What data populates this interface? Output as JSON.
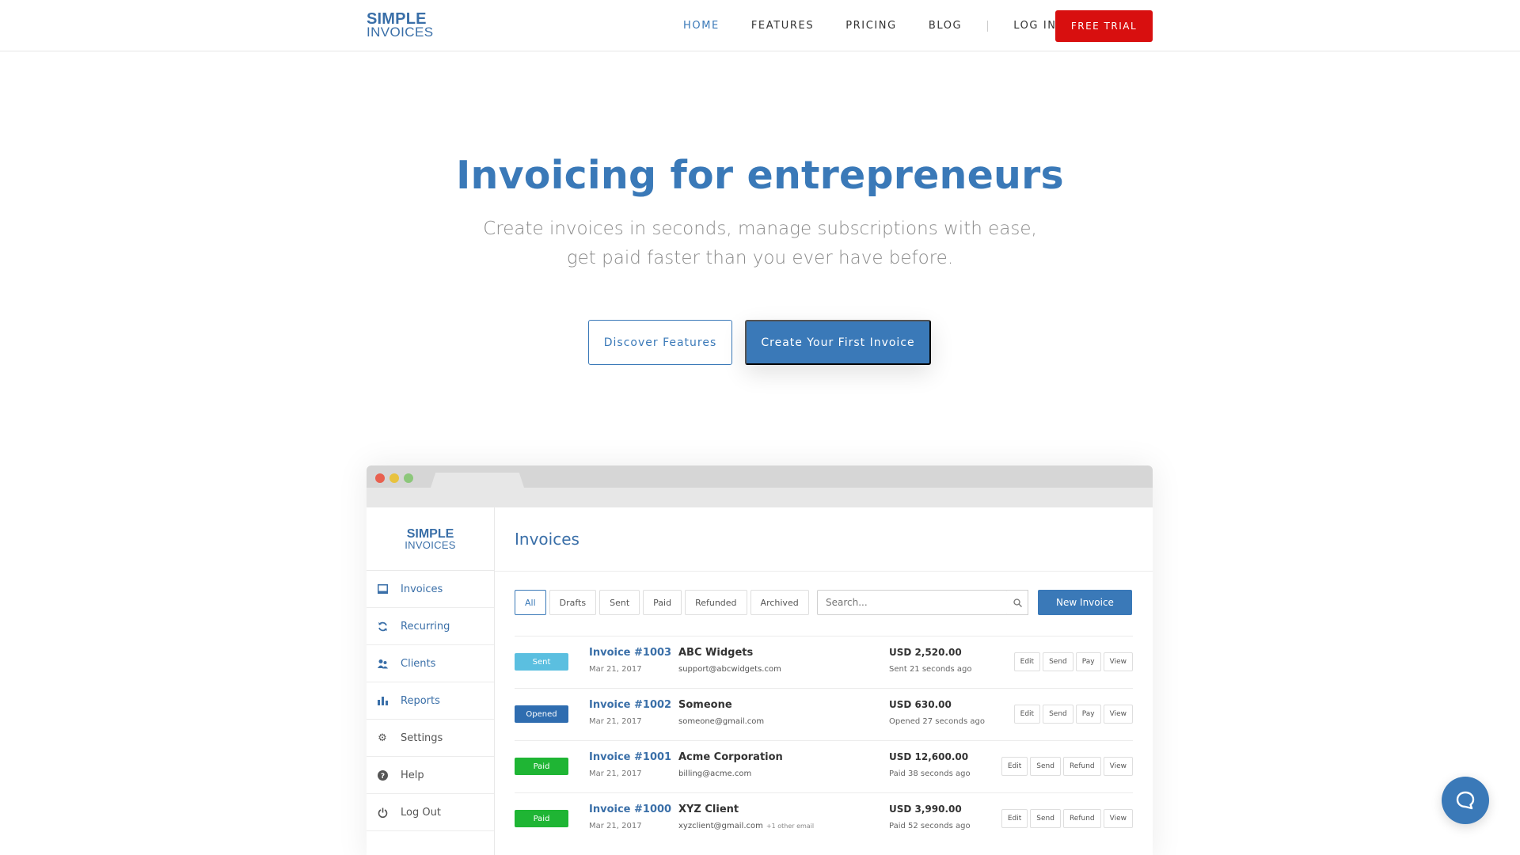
{
  "brand": {
    "line1": "SIMPLE",
    "line2": "INVOICES"
  },
  "nav": {
    "links": [
      "HOME",
      "FEATURES",
      "PRICING",
      "BLOG"
    ],
    "login": "LOG IN",
    "trial": "FREE TRIAL"
  },
  "hero": {
    "title": "Invoicing for entrepreneurs",
    "sub1": "Create invoices in seconds, manage subscriptions with ease,",
    "sub2": "get paid faster than you ever have before.",
    "btn_secondary": "Discover Features",
    "btn_primary": "Create Your First Invoice"
  },
  "app": {
    "brand": {
      "line1": "SIMPLE",
      "line2": "INVOICES"
    },
    "sidebar": [
      "Invoices",
      "Recurring",
      "Clients",
      "Reports",
      "Settings",
      "Help",
      "Log Out"
    ],
    "title": "Invoices",
    "filters": [
      "All",
      "Drafts",
      "Sent",
      "Paid",
      "Refunded",
      "Archived"
    ],
    "search_placeholder": "Search...",
    "new_button": "New Invoice",
    "rows": [
      {
        "status": "Sent",
        "color": "#5bbfe0",
        "number": "Invoice #1003",
        "date": "Mar 21, 2017",
        "client": "ABC Widgets",
        "email": "support@abcwidgets.com",
        "extra": "",
        "amount": "USD 2,520.00",
        "amount_status": "Sent 21 seconds ago",
        "actions": [
          "Edit",
          "Send",
          "Pay",
          "View"
        ]
      },
      {
        "status": "Opened",
        "color": "#2f6db0",
        "number": "Invoice #1002",
        "date": "Mar 21, 2017",
        "client": "Someone",
        "email": "someone@gmail.com",
        "extra": "",
        "amount": "USD 630.00",
        "amount_status": "Opened 27 seconds ago",
        "actions": [
          "Edit",
          "Send",
          "Pay",
          "View"
        ]
      },
      {
        "status": "Paid",
        "color": "#1fb534",
        "number": "Invoice #1001",
        "date": "Mar 21, 2017",
        "client": "Acme Corporation",
        "email": "billing@acme.com",
        "extra": "",
        "amount": "USD 12,600.00",
        "amount_status": "Paid 38 seconds ago",
        "actions": [
          "Edit",
          "Send",
          "Refund",
          "View"
        ]
      },
      {
        "status": "Paid",
        "color": "#1fb534",
        "number": "Invoice #1000",
        "date": "Mar 21, 2017",
        "client": "XYZ Client",
        "email": "xyzclient@gmail.com",
        "extra": "+1 other email",
        "amount": "USD 3,990.00",
        "amount_status": "Paid 52 seconds ago",
        "actions": [
          "Edit",
          "Send",
          "Refund",
          "View"
        ]
      }
    ]
  },
  "colors": {
    "accent": "#3a79b8",
    "trial": "#d80f0f"
  }
}
